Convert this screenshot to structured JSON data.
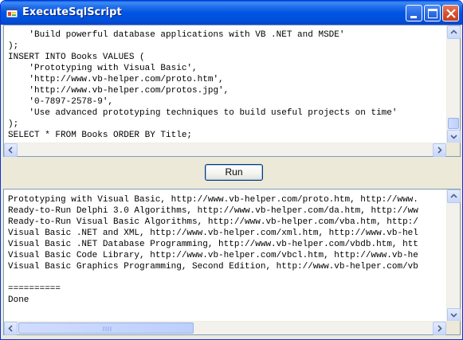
{
  "window": {
    "title": "ExecuteSqlScript"
  },
  "script_box": {
    "lines": [
      "    'Build powerful database applications with VB .NET and MSDE'",
      ");",
      "INSERT INTO Books VALUES (",
      "    'Prototyping with Visual Basic',",
      "    'http://www.vb-helper.com/proto.htm',",
      "    'http://www.vb-helper.com/protos.jpg',",
      "    '0-7897-2578-9',",
      "    'Use advanced prototyping techniques to build useful projects on time'",
      ");",
      "SELECT * FROM Books ORDER BY Title;"
    ]
  },
  "run_button": {
    "label": "Run"
  },
  "results_box": {
    "lines": [
      "Prototyping with Visual Basic, http://www.vb-helper.com/proto.htm, http://www.",
      "Ready-to-Run Delphi 3.0 Algorithms, http://www.vb-helper.com/da.htm, http://ww",
      "Ready-to-Run Visual Basic Algorithms, http://www.vb-helper.com/vba.htm, http:/",
      "Visual Basic .NET and XML, http://www.vb-helper.com/xml.htm, http://www.vb-hel",
      "Visual Basic .NET Database Programming, http://www.vb-helper.com/vbdb.htm, htt",
      "Visual Basic Code Library, http://www.vb-helper.com/vbcl.htm, http://www.vb-he",
      "Visual Basic Graphics Programming, Second Edition, http://www.vb-helper.com/vb",
      "",
      "==========",
      "Done"
    ]
  },
  "colors": {
    "titlebar": "#0054e3",
    "window_bg": "#ece9d8",
    "textbox_border": "#7f9db9"
  },
  "icons": {
    "app": "app-window-icon",
    "minimize": "minimize-icon",
    "maximize": "maximize-icon",
    "close": "close-icon"
  }
}
